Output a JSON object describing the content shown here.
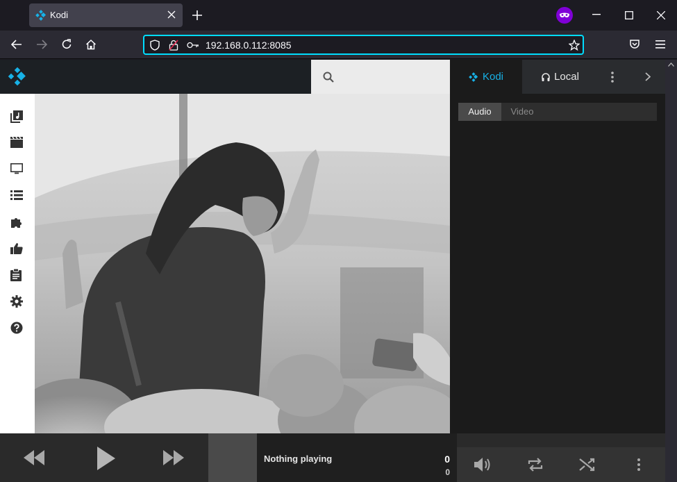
{
  "browser": {
    "tab_title": "Kodi",
    "url": "192.168.0.112:8085"
  },
  "kodi": {
    "right_tabs": {
      "kodi_label": "Kodi",
      "local_label": "Local"
    },
    "playlist_subtabs": {
      "audio_label": "Audio",
      "video_label": "Video",
      "active": "Audio"
    },
    "sidebar_items": [
      "music-icon",
      "movies-icon",
      "tv-icon",
      "playlist-icon",
      "addons-icon",
      "thumbs-up-icon",
      "clipboard-icon",
      "settings-icon",
      "help-icon"
    ],
    "player": {
      "now_playing": "Nothing playing",
      "time_main": "0",
      "time_sub": "0"
    },
    "colors": {
      "accent": "#17b2e7",
      "header": "#1c2024",
      "panel": "#1b1b1b"
    }
  }
}
